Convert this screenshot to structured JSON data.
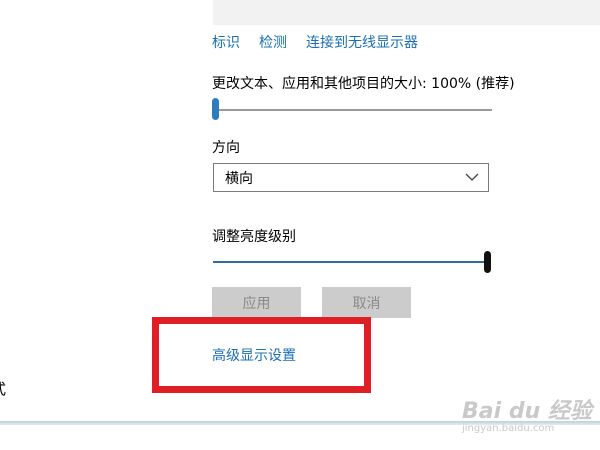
{
  "links": [
    "标识",
    "检测",
    "连接到无线显示器"
  ],
  "scale": {
    "label": "更改文本、应用和其他项目的大小: 100% (推荐)",
    "slider_fraction": 0.0
  },
  "orientation": {
    "label": "方向",
    "selected": "横向"
  },
  "brightness": {
    "label": "调整亮度级别",
    "slider_fraction": 1.0
  },
  "buttons": {
    "apply": "应用",
    "cancel": "取消"
  },
  "advanced_link": "高级显示设置",
  "left_cut_text": "式",
  "watermark": {
    "main": "Bai du 经验",
    "sub": "jingyan.baidu.com"
  },
  "colors": {
    "link": "#1a6fb3",
    "accent": "#2d6f9b",
    "highlight": "#e01e26",
    "disabled_button": "#cccccc"
  }
}
